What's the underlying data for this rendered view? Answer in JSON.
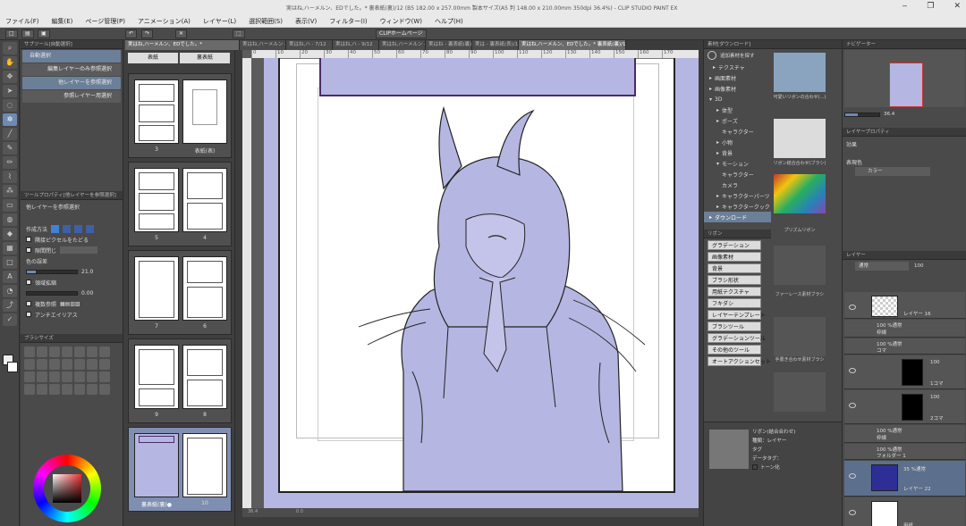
{
  "window": {
    "title": "実はね,ハーメルン、EDでした。* 裏表紙(裏)/12 (B5 182.00 x 257.00mm 製本サイズ(A5 判 148.00 x 210.00mm 350dpi 36.4%) - CLIP STUDIO PAINT EX",
    "controls": [
      "‒",
      "❐",
      "✕"
    ]
  },
  "menu": [
    "ファイル(F)",
    "編集(E)",
    "ページ管理(P)",
    "アニメーション(A)",
    "レイヤー(L)",
    "選択範囲(S)",
    "表示(V)",
    "フィルター(I)",
    "ウィンドウ(W)",
    "ヘルプ(H)"
  ],
  "command_bar": {
    "clip_home": "CLIPホームページ"
  },
  "tabs": [
    "実はね,ハーメルン、EDでした。*",
    "実はね,ハーメルン - 5/12",
    "実はね,ハ - 7/12",
    "実はね,ハ - 9/12",
    "実はね,ハーメルン - 10/12",
    "実はね - 裏表紙(裏)/12",
    "実は - 裏表紙(表)/12",
    "実はね,ハーメルン、EDでした。* 裏表紙(裏)/12"
  ],
  "subtool": {
    "header": "サブツール[自動選択]",
    "items": [
      "自動選択",
      "編集レイヤーのみ参照選択",
      "他レイヤーを参照選択",
      "参照レイヤー用選択"
    ],
    "property_header": "ツールプロパティ[他レイヤーを参照選択]",
    "property_title": "他レイヤーを参照選択",
    "props": {
      "method": "作成方法",
      "adjacent": "隣接ピクセルをたどる",
      "close_gap": "隙間閉じ",
      "color_margin": "色の誤差",
      "color_margin_value": "21.0",
      "expand": "領域拡縮",
      "expand_value": "0.00",
      "multi_ref": "複数参照",
      "antialias": "アンチエイリアス"
    },
    "brush_size_header": "ブラシサイズ"
  },
  "page_manager": {
    "cover_front": "表紙",
    "cover_back": "裏表紙",
    "labels": [
      "3",
      "表紙(表)",
      "5",
      "4",
      "7",
      "6",
      "9",
      "8",
      "裏表紙(裏)●",
      "10"
    ]
  },
  "canvas": {
    "ruler_ticks": [
      "0",
      "10",
      "20",
      "30",
      "40",
      "50",
      "60",
      "70",
      "80",
      "90",
      "100",
      "110",
      "120",
      "130",
      "140",
      "150",
      "160",
      "170"
    ],
    "zoom": "36.4",
    "angle": "0.0"
  },
  "material": {
    "header": "素材[ダウンロード]",
    "toolbar_label": "追加素材を探す",
    "tree": [
      "テクスチャ",
      "画面素材",
      "画像素材",
      "3D",
      "体型",
      "ポーズ",
      "キャラクター",
      "小物",
      "背景",
      "モーション",
      "キャラクター",
      "カメラ",
      "キャラクターパーツ",
      "キャラクタークック",
      "ダウンロード"
    ],
    "tag_header": "リボン",
    "tags": [
      "グラデーション",
      "画像素材",
      "背景",
      "ブラシ形状",
      "用紙テクスチャ",
      "フキダシ",
      "レイヤーテンプレート",
      "ブラシツール",
      "グラデーションツール",
      "その他のツール",
      "オートアクションセット"
    ],
    "captions": [
      "可愛いリボンの合わせ(...)",
      "リボン結合合わせ(ブラシ)",
      "プリズムリボン",
      "ファーレース素材ブラシ",
      "手書き合わせ素材ブラシ"
    ],
    "detail": {
      "name": "リボン(結合合わせ)",
      "type_label": "種類：",
      "type_value": "レイヤー",
      "tag_label": "タグ",
      "data_tag_label": "データタグ：",
      "tone_label": "トーン化"
    }
  },
  "right": {
    "navigator_header": "ナビゲーター",
    "layer_property_header": "レイヤープロパティ",
    "effect_label": "効果",
    "expression_label": "表現色",
    "expression_value": "カラー",
    "layer_header": "レイヤー",
    "blend_mode": "通常",
    "opacity": "100",
    "layers": [
      {
        "name": "レイヤー 16",
        "sub": ""
      },
      {
        "name": "100 %通常",
        "sub": "枠線"
      },
      {
        "name": "100 %通常",
        "sub": "コマ"
      },
      {
        "name": "100",
        "sub": "1コマ"
      },
      {
        "name": "100",
        "sub": "2コマ"
      },
      {
        "name": "100 %通常",
        "sub": "枠線"
      },
      {
        "name": "100 %通常",
        "sub": "フォルダー 1"
      },
      {
        "name": "35 %通常",
        "sub": "レイヤー 22"
      },
      {
        "name": "",
        "sub": "用紙"
      }
    ]
  },
  "colors": {
    "accent": "#6c7f98",
    "page_tint": "#b6b6e2",
    "panel": "#4a4a4a"
  }
}
